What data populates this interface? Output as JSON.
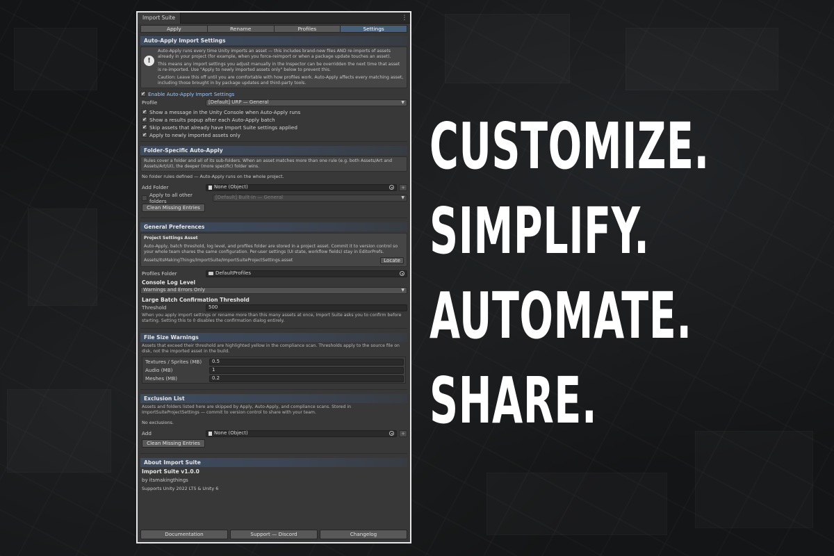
{
  "window": {
    "tab_title": "Import Suite",
    "tabs": [
      "Apply",
      "Rename",
      "Profiles",
      "Settings"
    ],
    "active_tab": "Settings"
  },
  "auto_apply": {
    "header": "Auto-Apply Import Settings",
    "help_p1": "Auto-Apply runs every time Unity imports an asset — this includes brand-new files AND re-imports of assets already in your project (for example, when you force-reimport or when a package update touches an asset).",
    "help_p2": "This means any import settings you adjust manually in the Inspector can be overridden the next time that asset is re-imported. Use \"Apply to newly imported assets only\" below to prevent this.",
    "help_p3": "Caution: Leave this off until you are comfortable with how profiles work. Auto-Apply affects every matching asset, including those brought in by package updates and third-party tools.",
    "enable_label": "Enable Auto-Apply Import Settings",
    "profile_label": "Profile",
    "profile_value": "[Default] URP — General",
    "options": [
      "Show a message in the Unity Console when Auto-Apply runs",
      "Show a results popup after each Auto-Apply batch",
      "Skip assets that already have Import Suite settings applied",
      "Apply to newly imported assets only"
    ]
  },
  "folder_specific": {
    "header": "Folder-Specific Auto-Apply",
    "help": "Rules cover a folder and all of its sub-folders. When an asset matches more than one rule (e.g. both Assets/Art and Assets/Art/UI), the deeper (more specific) folder wins.",
    "empty_note": "No folder rules defined — Auto-Apply runs on the whole project.",
    "add_folder_label": "Add Folder",
    "add_folder_value": "None (Object)",
    "other_folders_label": "Apply to all other folders",
    "other_folders_value": "[Default] Built-in — General",
    "clean_button": "Clean Missing Entries"
  },
  "general": {
    "header": "General Preferences",
    "asset_title": "Project Settings Asset",
    "asset_help": "Auto-Apply, batch threshold, log level, and profiles folder are stored in a project asset. Commit it to version control so your whole team shares the same configuration. Per-user settings (UI state, workflow fields) stay in EditorPrefs.",
    "asset_path": "Assets/ItsMakingThings/ImportSuite/ImportSuiteProjectSettings.asset",
    "locate_button": "Locate",
    "profiles_folder_label": "Profiles Folder",
    "profiles_folder_value": "DefaultProfiles",
    "log_level_title": "Console Log Level",
    "log_level_value": "Warnings and Errors Only",
    "batch_title": "Large Batch Confirmation Threshold",
    "threshold_label": "Threshold",
    "threshold_value": "500",
    "batch_help": "When you apply import settings or rename more than this many assets at once, Import Suite asks you to confirm before starting. Setting this to 0 disables the confirmation dialog entirely."
  },
  "file_size": {
    "header": "File Size Warnings",
    "help": "Assets that exceed their threshold are highlighted yellow in the compliance scan. Thresholds apply to the source file on disk, not the imported asset in the build.",
    "rows": [
      {
        "label": "Textures / Sprites  (MB)",
        "value": "0.5"
      },
      {
        "label": "Audio  (MB)",
        "value": "1"
      },
      {
        "label": "Meshes  (MB)",
        "value": "0.2"
      }
    ]
  },
  "exclusion": {
    "header": "Exclusion List",
    "help": "Assets and folders listed here are skipped by Apply, Auto-Apply, and compliance scans. Stored in ImportSuiteProjectSettings — commit to version control to share with your team.",
    "empty_note": "No exclusions.",
    "add_label": "Add",
    "add_value": "None (Object)",
    "clean_button": "Clean Missing Entries"
  },
  "about": {
    "header": "About Import Suite",
    "title": "Import Suite  v1.0.0",
    "author": "by itsmakingthings",
    "support": "Supports Unity 2022 LTS & Unity 6"
  },
  "footer": {
    "documentation": "Documentation",
    "support": "Support — Discord",
    "changelog": "Changelog"
  },
  "tagline": [
    "CUSTOMIZE.",
    "SIMPLIFY.",
    "AUTOMATE.",
    "SHARE."
  ]
}
